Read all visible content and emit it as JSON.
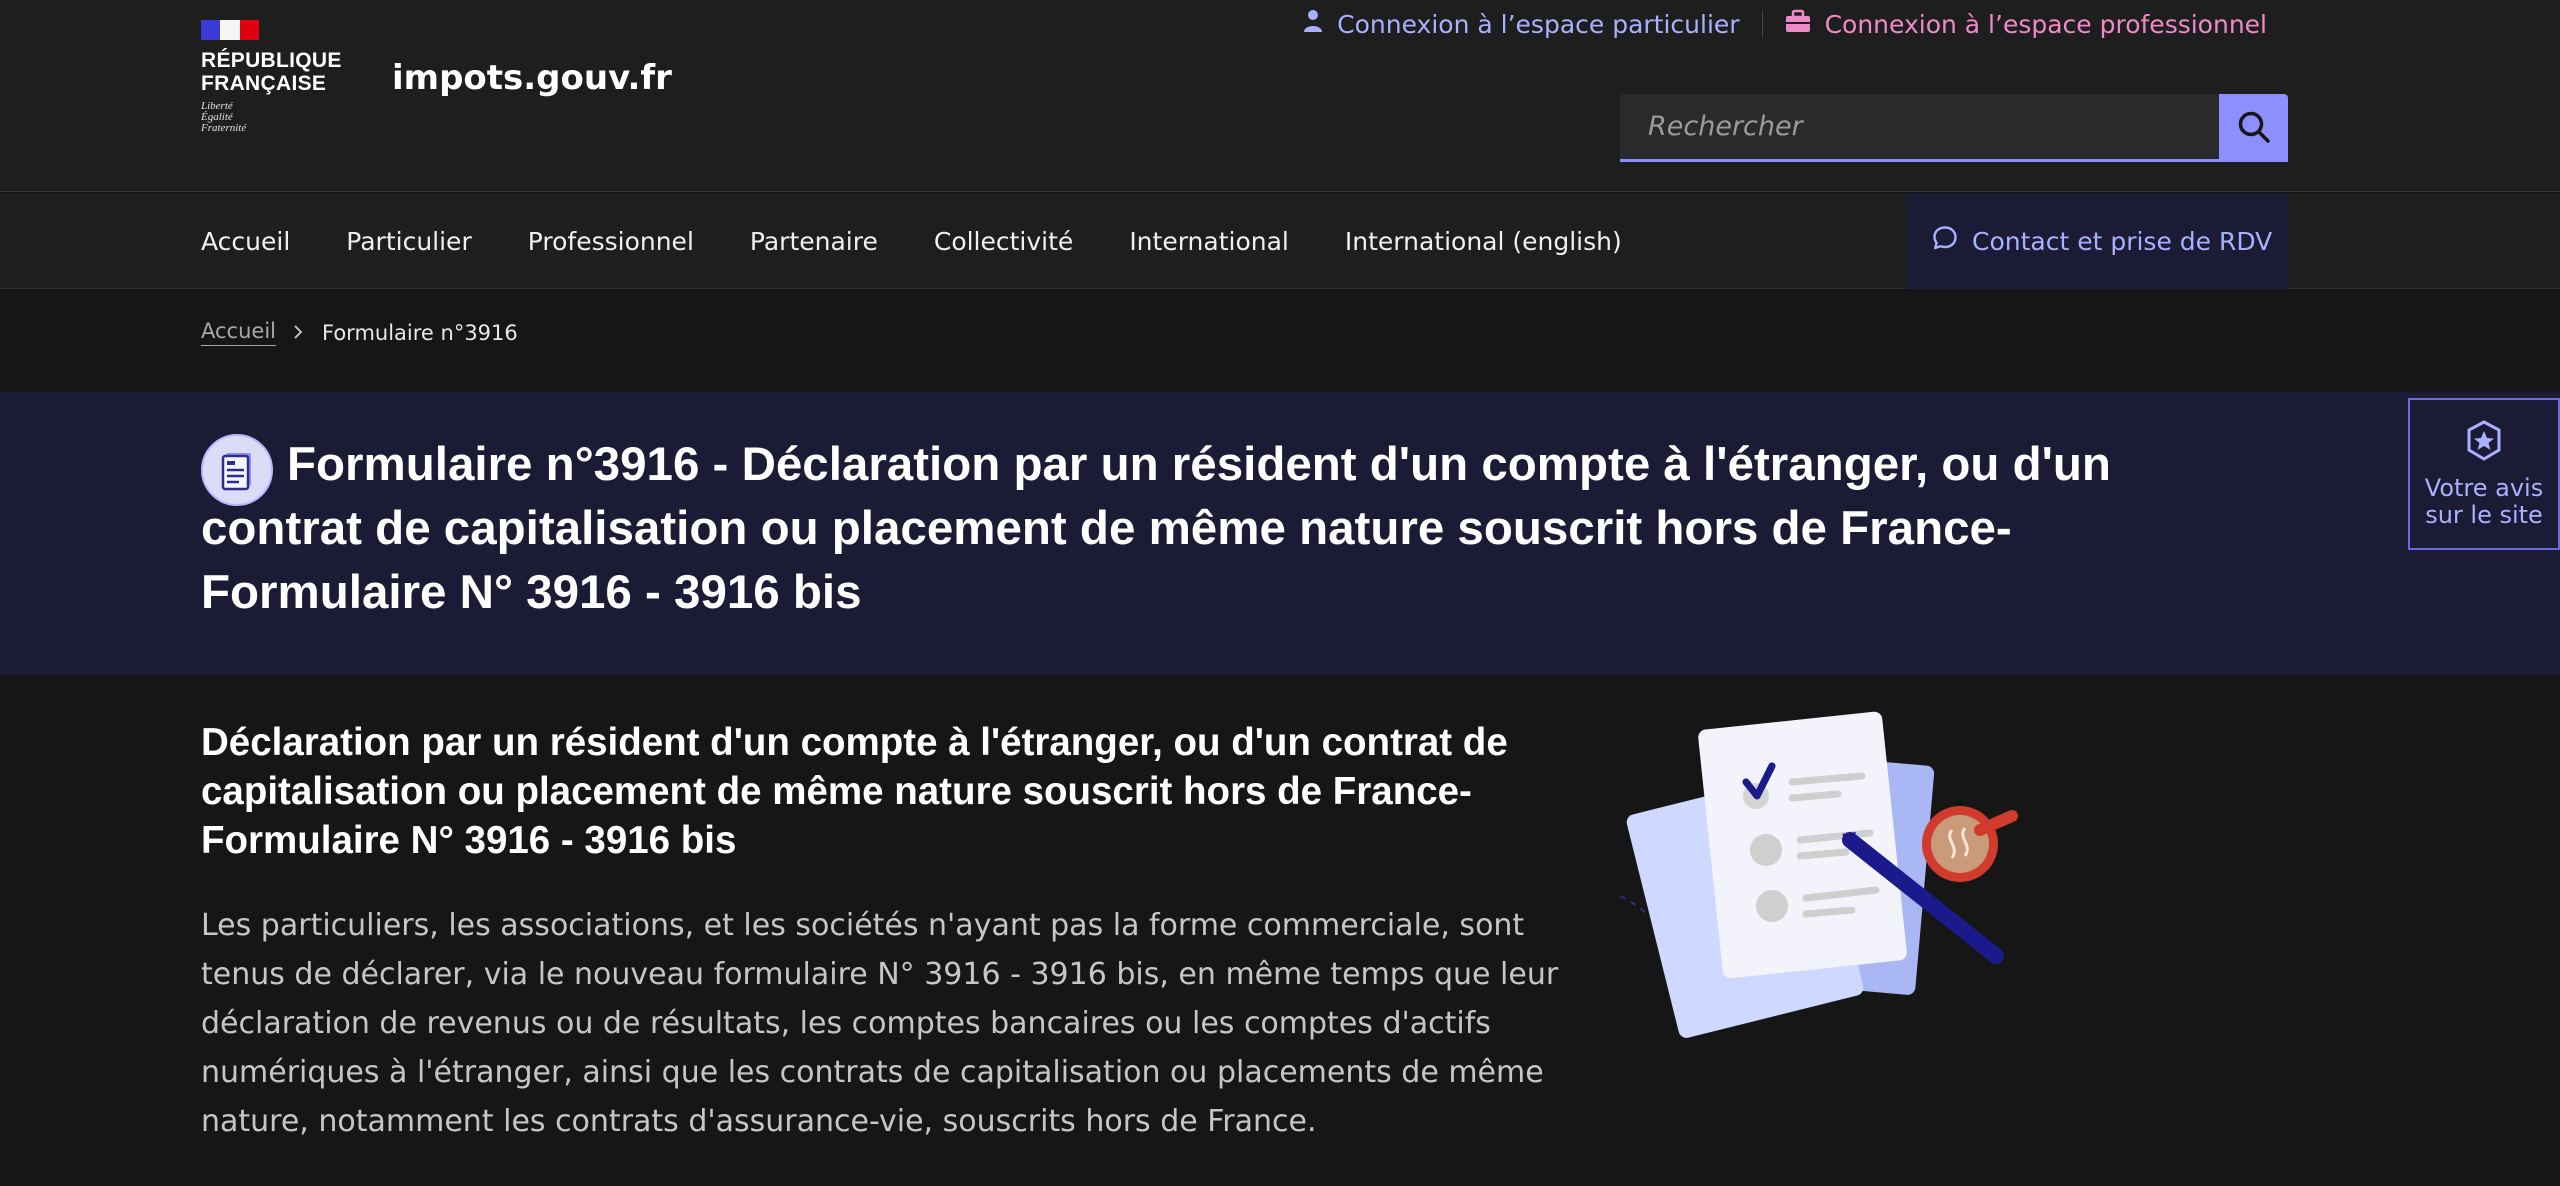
{
  "header": {
    "logo": {
      "line1": "RÉPUBLIQUE",
      "line2": "FRANÇAISE",
      "motto1": "Liberté",
      "motto2": "Égalité",
      "motto3": "Fraternité"
    },
    "site_name": "impots.gouv.fr",
    "link_particulier": "Connexion à l’espace particulier",
    "link_professionnel": "Connexion à l’espace professionnel",
    "search_placeholder": "Rechercher"
  },
  "nav": {
    "items": [
      "Accueil",
      "Particulier",
      "Professionnel",
      "Partenaire",
      "Collectivité",
      "International",
      "International (english)"
    ],
    "contact": "Contact et prise de RDV"
  },
  "breadcrumb": {
    "home": "Accueil",
    "current": "Formulaire n°3916"
  },
  "hero": {
    "title": "Formulaire n°3916 - Déclaration par un résident d'un compte à l'étranger, ou d'un contrat de capitalisation ou placement de même nature souscrit hors de France- Formulaire N° 3916 - 3916 bis"
  },
  "feedback": {
    "line1": "Votre avis",
    "line2": "sur le site"
  },
  "content": {
    "heading": "Déclaration par un résident d'un compte à l'étranger, ou d'un contrat de capitalisation ou placement de même nature souscrit hors de France- Formulaire N° 3916 - 3916 bis",
    "paragraph": "Les particuliers, les associations, et les sociétés n'ayant pas la forme commerciale, sont tenus de déclarer, via le nouveau formulaire N° 3916 - 3916 bis, en même temps que leur déclaration de revenus ou de résultats, les comptes bancaires ou les comptes d'actifs numériques à l'étranger, ainsi que les contrats de capitalisation ou placements de même nature, notamment les contrats d'assurance-vie, souscrits hors de France."
  },
  "colors": {
    "accent": "#8d8fff",
    "link_particulier": "#a9b0ff",
    "link_professionnel": "#ef8ac8",
    "hero_bg": "#1b1b35"
  },
  "icons": [
    "user-icon",
    "briefcase-icon",
    "search-icon",
    "chat-bubble-icon",
    "chevron-right-icon",
    "form-document-icon",
    "star-badge-icon"
  ]
}
